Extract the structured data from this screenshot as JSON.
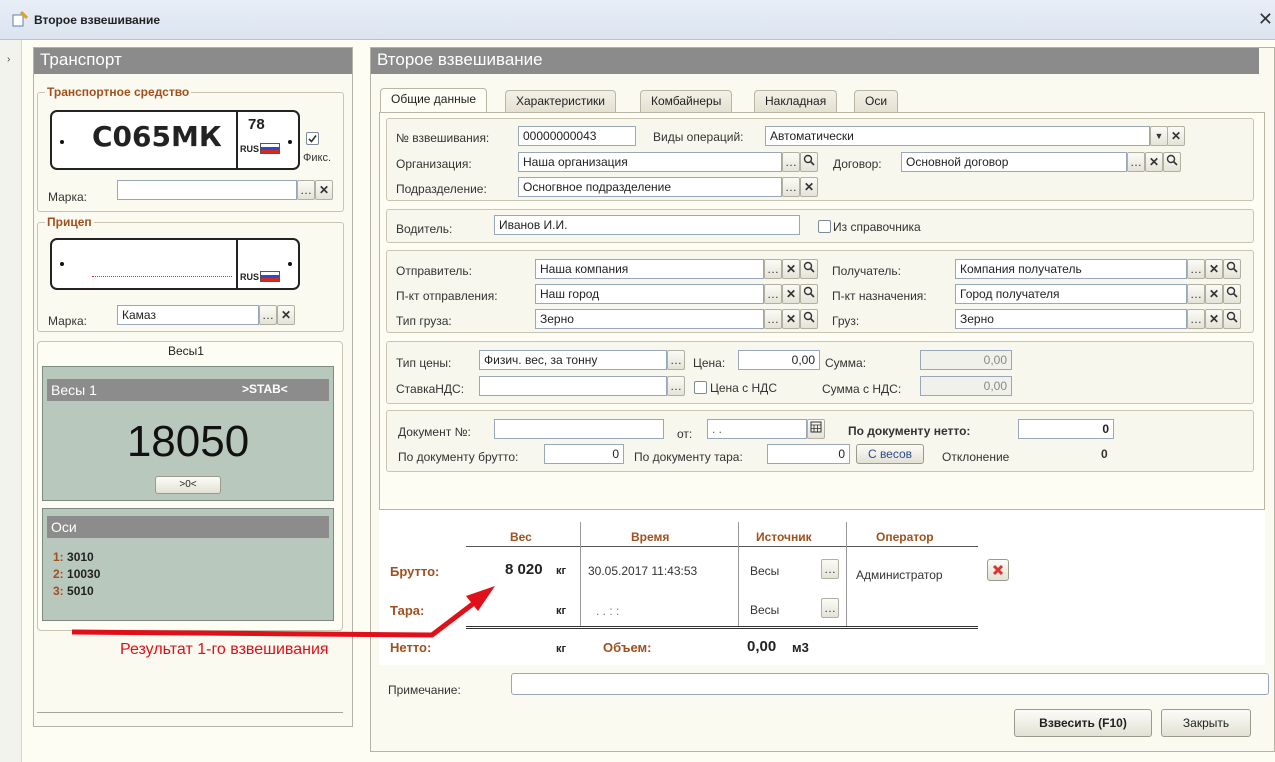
{
  "window": {
    "title": "Второе взвешивание",
    "close": "✕"
  },
  "transport": {
    "header": "Транспорт",
    "vehicle_group": "Транспортное средство",
    "plate_number": "С065МК",
    "plate_region": "78",
    "plate_country": "RUS",
    "fix_label": "Фикс.",
    "fix_checked": true,
    "brand_label": "Марка:",
    "brand_value": "",
    "trailer_group": "Прицеп",
    "trailer_plate_country": "RUS",
    "trailer_brand_label": "Марка:",
    "trailer_brand_value": "Камаз"
  },
  "scales": {
    "tab": "Весы1",
    "name": "Весы 1",
    "status": ">STAB<",
    "weight": "18050",
    "zero_button": ">0<",
    "axles_header": "Оси",
    "axles": [
      {
        "n": "1:",
        "v": "3010"
      },
      {
        "n": "2:",
        "v": "10030"
      },
      {
        "n": "3:",
        "v": "5010"
      }
    ]
  },
  "main": {
    "header": "Второе взвешивание",
    "tabs": [
      "Общие данные",
      "Характеристики",
      "Комбайнеры",
      "Накладная",
      "Оси"
    ],
    "weighing_no_label": "№ взвешивания:",
    "weighing_no": "00000000043",
    "operation_type_label": "Виды операций:",
    "operation_type": "Автоматически",
    "org_label": "Организация:",
    "org": "Наша организация",
    "contract_label": "Договор:",
    "contract": "Основной договор",
    "division_label": "Подразделение:",
    "division": "Осногвное подразделение",
    "driver_label": "Водитель:",
    "driver": "Иванов И.И.",
    "from_directory_label": "Из справочника",
    "sender_label": "Отправитель:",
    "sender": "Наша компания",
    "recipient_label": "Получатель:",
    "recipient": "Компания получатель",
    "origin_label": "П-кт отправления:",
    "origin": "Наш город",
    "destination_label": "П-кт назначения:",
    "destination": "Город получателя",
    "cargo_type_label": "Тип груза:",
    "cargo_type": "Зерно",
    "cargo_label": "Груз:",
    "cargo": "Зерно",
    "price_type_label": "Тип цены:",
    "price_type": "Физич. вес, за тонну",
    "price_label": "Цена:",
    "price": "0,00",
    "sum_label": "Сумма:",
    "sum": "0,00",
    "vat_label": "СтавкаНДС:",
    "vat": "",
    "price_with_vat_label": "Цена с НДС",
    "sum_with_vat_label": "Сумма с НДС:",
    "sum_with_vat": "0,00",
    "doc_no_label": "Документ №:",
    "doc_no": "",
    "from_label": "от:",
    "doc_date": ". .",
    "doc_net_label": "По документу нетто:",
    "doc_net": "0",
    "doc_gross_label": "По документу брутто:",
    "doc_gross": "0",
    "doc_tare_label": "По документу тара:",
    "doc_tare": "0",
    "from_scales_button": "С весов",
    "deviation_label": "Отклонение",
    "deviation": "0"
  },
  "weigh_table": {
    "headers": {
      "weight": "Вес",
      "time": "Время",
      "source": "Источник",
      "operator": "Оператор"
    },
    "gross_label": "Брутто:",
    "gross_weight": "8 020",
    "unit": "кг",
    "gross_time": "30.05.2017 11:43:53",
    "gross_source": "Весы",
    "gross_operator": "Администратор",
    "tare_label": "Тара:",
    "tare_unit": "кг",
    "tare_time": ". .    : :",
    "tare_source": "Весы",
    "net_label": "Нетто:",
    "net_unit": "кг",
    "volume_label": "Объем:",
    "volume": "0,00",
    "volume_unit": "м3"
  },
  "note_label": "Примечание:",
  "note": "",
  "annotation": "Результат 1-го взвешивания",
  "buttons": {
    "weigh": "Взвесить (F10)",
    "close": "Закрыть"
  },
  "colors": {
    "header_bg": "#8b8b8b",
    "label_accent": "#a0501e",
    "scale_bg": "#b8c8bd",
    "arrow": "#e0101a"
  }
}
